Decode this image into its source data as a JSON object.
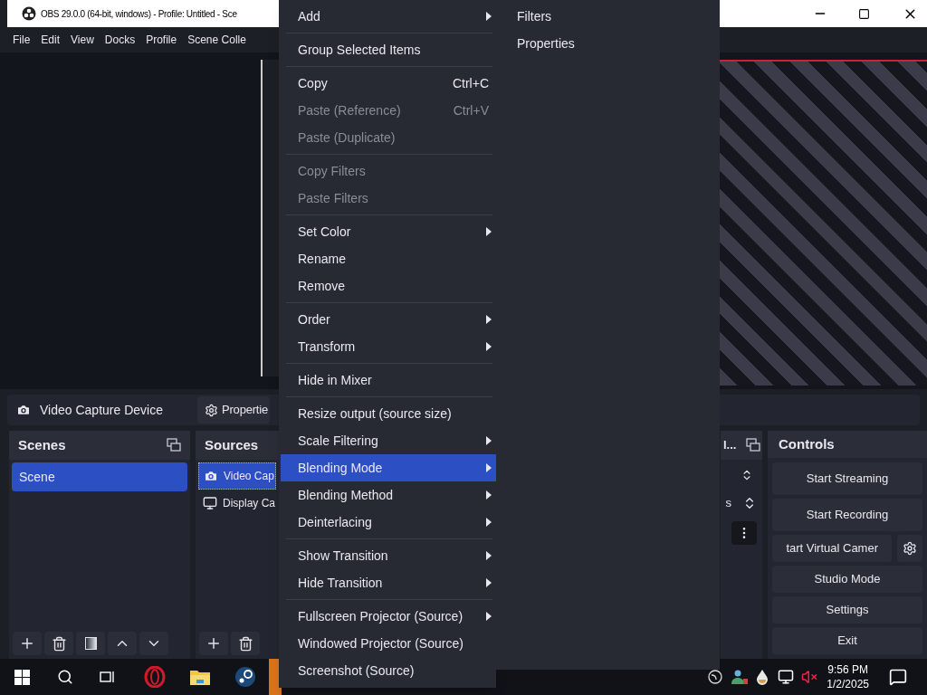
{
  "window": {
    "title": "OBS 29.0.0 (64-bit, windows) - Profile: Untitled - Sce"
  },
  "menu_bar": [
    "File",
    "Edit",
    "View",
    "Docks",
    "Profile",
    "Scene Colle"
  ],
  "source_toolbar": {
    "source_name": "Video Capture Device",
    "properties_button": "Propertie"
  },
  "scenes_dock": {
    "title": "Scenes",
    "items": [
      {
        "label": "Scene",
        "selected": true
      }
    ]
  },
  "sources_dock": {
    "title": "Sources",
    "items": [
      {
        "label": "Video Cap",
        "kind": "camera",
        "selected": true
      },
      {
        "label": "Display Ca",
        "kind": "display",
        "selected": false
      }
    ]
  },
  "mixer_dock": {
    "title": "l...",
    "field_text": "s"
  },
  "controls_dock": {
    "title": "Controls",
    "buttons": [
      {
        "label": "Start Streaming",
        "kind": "plain"
      },
      {
        "label": "Start Recording",
        "kind": "plain"
      },
      {
        "label": "tart Virtual Camer",
        "kind": "with_gear"
      },
      {
        "label": "Studio Mode",
        "kind": "plain"
      },
      {
        "label": "Settings",
        "kind": "plain"
      },
      {
        "label": "Exit",
        "kind": "plain"
      }
    ]
  },
  "context_menu": {
    "items": [
      {
        "kind": "item",
        "label": "Add",
        "submenu": true,
        "disabled": false,
        "selected": false
      },
      {
        "kind": "separator"
      },
      {
        "kind": "item",
        "label": "Group Selected Items",
        "submenu": false,
        "disabled": false,
        "selected": false
      },
      {
        "kind": "separator"
      },
      {
        "kind": "item",
        "label": "Copy",
        "shortcut": "Ctrl+C",
        "submenu": false,
        "disabled": false,
        "selected": false
      },
      {
        "kind": "item",
        "label": "Paste (Reference)",
        "shortcut": "Ctrl+V",
        "submenu": false,
        "disabled": true,
        "selected": false
      },
      {
        "kind": "item",
        "label": "Paste (Duplicate)",
        "submenu": false,
        "disabled": true,
        "selected": false
      },
      {
        "kind": "separator"
      },
      {
        "kind": "item",
        "label": "Copy Filters",
        "submenu": false,
        "disabled": true,
        "selected": false
      },
      {
        "kind": "item",
        "label": "Paste Filters",
        "submenu": false,
        "disabled": true,
        "selected": false
      },
      {
        "kind": "separator"
      },
      {
        "kind": "item",
        "label": "Set Color",
        "submenu": true,
        "disabled": false,
        "selected": false
      },
      {
        "kind": "item",
        "label": "Rename",
        "submenu": false,
        "disabled": false,
        "selected": false
      },
      {
        "kind": "item",
        "label": "Remove",
        "submenu": false,
        "disabled": false,
        "selected": false
      },
      {
        "kind": "separator"
      },
      {
        "kind": "item",
        "label": "Order",
        "submenu": true,
        "disabled": false,
        "selected": false
      },
      {
        "kind": "item",
        "label": "Transform",
        "submenu": true,
        "disabled": false,
        "selected": false
      },
      {
        "kind": "separator"
      },
      {
        "kind": "item",
        "label": "Hide in Mixer",
        "submenu": false,
        "disabled": false,
        "selected": false
      },
      {
        "kind": "separator"
      },
      {
        "kind": "item",
        "label": "Resize output (source size)",
        "submenu": false,
        "disabled": false,
        "selected": false
      },
      {
        "kind": "item",
        "label": "Scale Filtering",
        "submenu": true,
        "disabled": false,
        "selected": false
      },
      {
        "kind": "item",
        "label": "Blending Mode",
        "submenu": true,
        "disabled": false,
        "selected": true
      },
      {
        "kind": "item",
        "label": "Blending Method",
        "submenu": true,
        "disabled": false,
        "selected": false
      },
      {
        "kind": "item",
        "label": "Deinterlacing",
        "submenu": true,
        "disabled": false,
        "selected": false
      },
      {
        "kind": "separator"
      },
      {
        "kind": "item",
        "label": "Show Transition",
        "submenu": true,
        "disabled": false,
        "selected": false
      },
      {
        "kind": "item",
        "label": "Hide Transition",
        "submenu": true,
        "disabled": false,
        "selected": false
      },
      {
        "kind": "separator"
      },
      {
        "kind": "item",
        "label": "Fullscreen Projector (Source)",
        "submenu": true,
        "disabled": false,
        "selected": false
      },
      {
        "kind": "item",
        "label": "Windowed Projector (Source)",
        "submenu": false,
        "disabled": false,
        "selected": false
      },
      {
        "kind": "item",
        "label": "Screenshot (Source)",
        "submenu": false,
        "disabled": false,
        "selected": false
      }
    ]
  },
  "submenu": {
    "items": [
      "Filters",
      "Properties"
    ]
  },
  "taskbar": {
    "time": "9:56 PM",
    "date": "1/2/2025"
  }
}
